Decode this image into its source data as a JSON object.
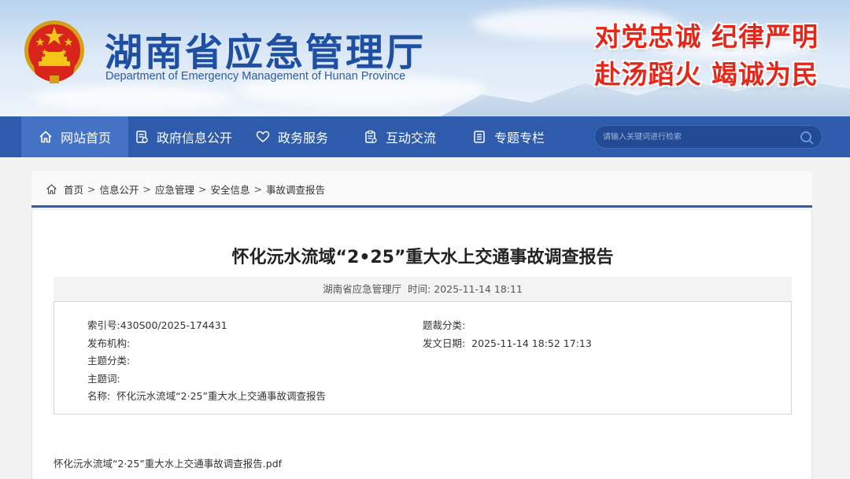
{
  "header": {
    "title_cn": "湖南省应急管理厅",
    "title_en": "Department of Emergency Management of Hunan Province",
    "slogan_line1": "对党忠诚  纪律严明",
    "slogan_line2": "赴汤蹈火  竭诚为民"
  },
  "nav": {
    "items": [
      {
        "label": "网站首页",
        "icon": "home-icon"
      },
      {
        "label": "政府信息公开",
        "icon": "document-icon"
      },
      {
        "label": "政务服务",
        "icon": "heart-hand-icon"
      },
      {
        "label": "互动交流",
        "icon": "clipboard-icon"
      },
      {
        "label": "专题专栏",
        "icon": "list-doc-icon"
      }
    ],
    "search_placeholder": "请输入关键词进行检索"
  },
  "breadcrumb": {
    "items": [
      "首页",
      "信息公开",
      "应急管理",
      "安全信息",
      "事故调查报告"
    ],
    "separator": ">"
  },
  "article": {
    "title": "怀化沅水流域“2•25”重大水上交通事故调查报告",
    "publisher": "湖南省应急管理厅",
    "time_label": "时间:",
    "time_value": "2025-11-14 18:11",
    "info": {
      "index_label": "索引号:",
      "index_value": "430S00/2025-174431",
      "genre_label": "题裁分类:",
      "genre_value": "",
      "issuer_label": "发布机构:",
      "issuer_value": "",
      "date_label": "发文日期:",
      "date_value": "2025-11-14 18:52 17:13",
      "topic_label": "主题分类:",
      "topic_value": "",
      "keyword_label": "主题词:",
      "keyword_value": "",
      "name_label": "名称:",
      "name_value": "怀化沅水流域“2·25”重大水上交通事故调查报告"
    },
    "attachment": "怀化沅水流域“2·25”重大水上交通事故调查报告.pdf"
  },
  "colors": {
    "nav_bg": "#2e5bab",
    "nav_active": "#4472c4",
    "title_blue": "#1f4fa2",
    "slogan_red": "#e2281b"
  }
}
